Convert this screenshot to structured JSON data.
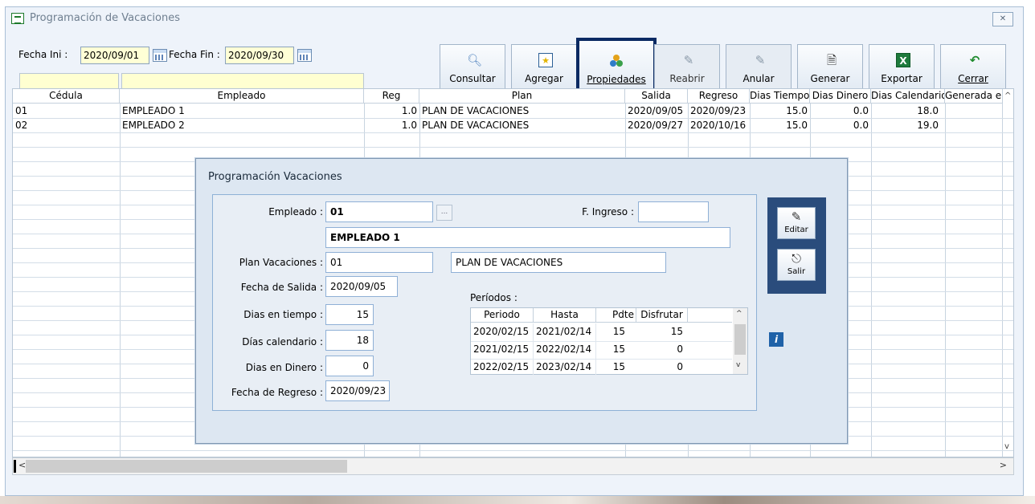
{
  "window": {
    "title": "Programación de Vacaciones",
    "close_label": "✕"
  },
  "filters": {
    "fecha_ini_label": "Fecha Ini :",
    "fecha_ini": "2020/09/01",
    "fecha_fin_label": "Fecha Fin :",
    "fecha_fin": "2020/09/30"
  },
  "toolbar": {
    "consultar": "Consultar",
    "agregar": "Agregar",
    "propiedades": "Propiedades",
    "reabrir": "Reabrir",
    "anular": "Anular",
    "generar": "Generar",
    "exportar": "Exportar",
    "cerrar": "Cerrar"
  },
  "grid": {
    "columns": [
      "Cédula",
      "Empleado",
      "Reg",
      "Plan",
      "Salida",
      "Regreso",
      "Dias Tiempo",
      "Dias Dinero",
      "Dias Calendario",
      "Generada en"
    ],
    "rows": [
      {
        "cedula": "01",
        "empleado": "EMPLEADO 1",
        "reg": "1.0",
        "plan": "PLAN DE VACACIONES",
        "salida": "2020/09/05",
        "regreso": "2020/09/23",
        "dias_tiempo": "15.0",
        "dias_dinero": "0.0",
        "dias_calendario": "18.0"
      },
      {
        "cedula": "02",
        "empleado": "EMPLEADO 2",
        "reg": "1.0",
        "plan": "PLAN DE VACACIONES",
        "salida": "2020/09/27",
        "regreso": "2020/10/16",
        "dias_tiempo": "15.0",
        "dias_dinero": "0.0",
        "dias_calendario": "19.0"
      }
    ],
    "scroll_left_label": "<",
    "scroll_right_label": ">"
  },
  "dialog": {
    "title": "Programación Vacaciones",
    "empleado_label": "Empleado :",
    "empleado_code": "01",
    "lookup_label": "...",
    "f_ingreso_label": "F. Ingreso :",
    "f_ingreso": "",
    "empleado_name": "EMPLEADO 1",
    "plan_label": "Plan Vacaciones :",
    "plan_code": "01",
    "plan_name": "PLAN DE VACACIONES",
    "fecha_salida_label": "Fecha de Salida :",
    "fecha_salida": "2020/09/05",
    "dias_tiempo_label": "Dias en tiempo :",
    "dias_tiempo": "15",
    "dias_calendario_label": "Días calendario :",
    "dias_calendario": "18",
    "dias_dinero_label": "Dias en Dinero :",
    "dias_dinero": "0",
    "fecha_regreso_label": "Fecha de Regreso :",
    "fecha_regreso": "2020/09/23",
    "periodos_label": "Períodos :",
    "periodos_columns": [
      "Periodo",
      "Hasta",
      "Pdte",
      "Disfrutar"
    ],
    "periodos": [
      {
        "periodo": "2020/02/15",
        "hasta": "2021/02/14",
        "pdte": "15",
        "disfrutar": "15"
      },
      {
        "periodo": "2021/02/15",
        "hasta": "2022/02/14",
        "pdte": "15",
        "disfrutar": "0"
      },
      {
        "periodo": "2022/02/15",
        "hasta": "2023/02/14",
        "pdte": "15",
        "disfrutar": "0"
      }
    ],
    "editar_label": "Editar",
    "salir_label": "Salir",
    "info_label": "i"
  }
}
